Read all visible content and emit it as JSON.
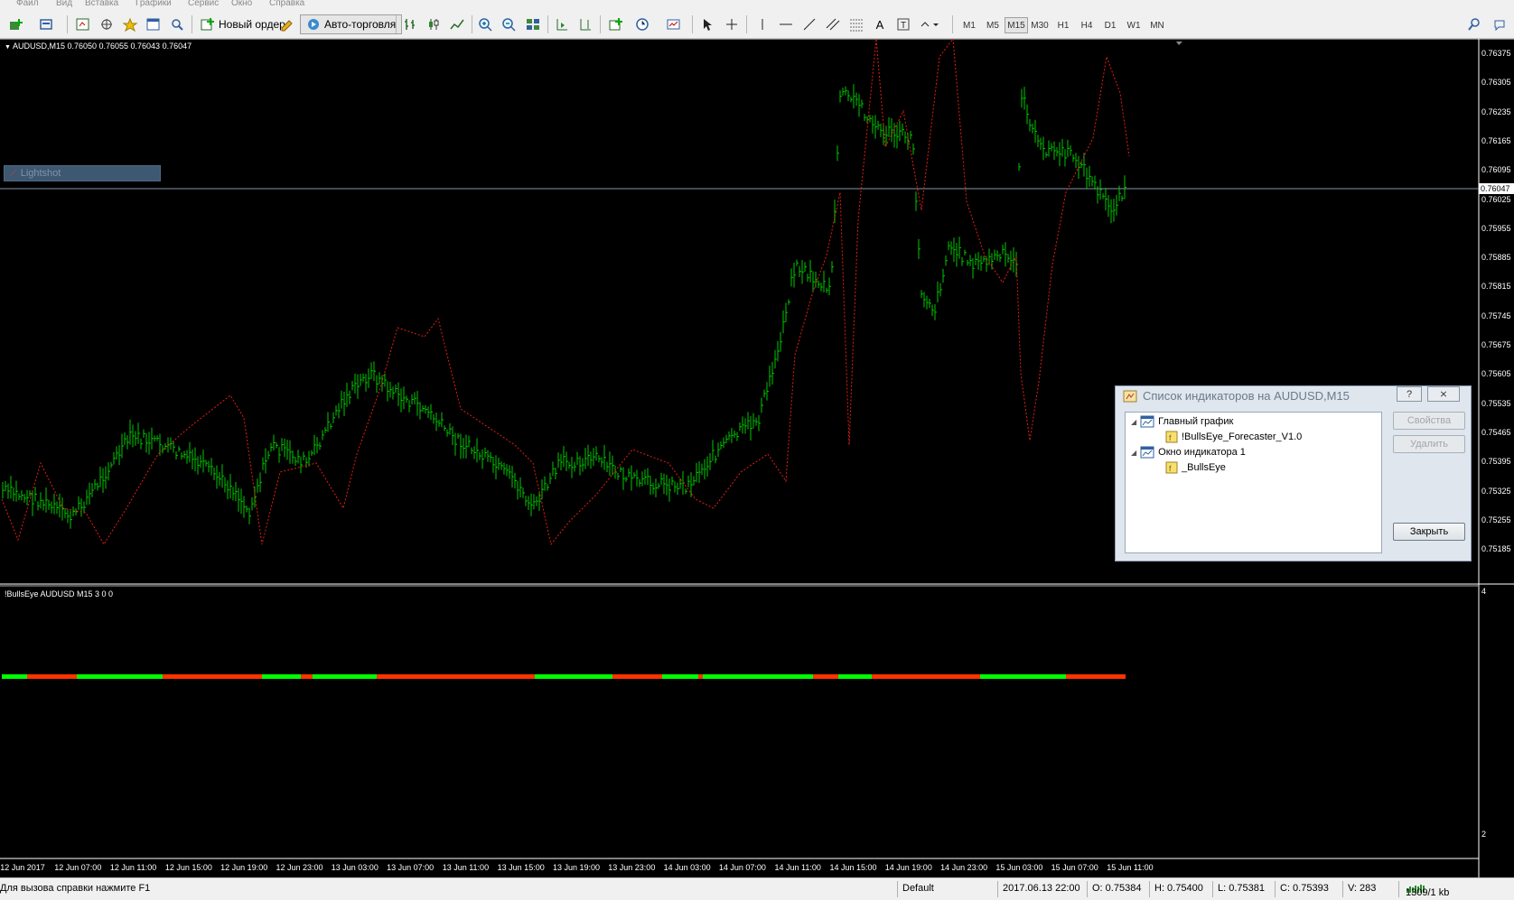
{
  "menu": [
    "Файл",
    "Вид",
    "Вставка",
    "Графики",
    "Сервис",
    "Окно",
    "Справка"
  ],
  "toolbar": {
    "new_order": "Новый ордер",
    "auto_trading": "Авто-торговля",
    "timeframes": [
      "M1",
      "M5",
      "M15",
      "M30",
      "H1",
      "H4",
      "D1",
      "W1",
      "MN"
    ],
    "active_timeframe": "M15"
  },
  "chart": {
    "header": "AUDUSD,M15  0.76050 0.76055 0.76043 0.76047",
    "subwindow_header": "!BullsEye AUDUSD M15 3 0 0",
    "lightshot_label": "Lightshot",
    "current_price": "0.76047",
    "price_labels": [
      "0.76375",
      "0.76305",
      "0.76235",
      "0.76165",
      "0.76095",
      "0.76025",
      "0.75955",
      "0.75885",
      "0.75815",
      "0.75745",
      "0.75675",
      "0.75605",
      "0.75535",
      "0.75465",
      "0.75395",
      "0.75325",
      "0.75255",
      "0.75185"
    ],
    "sub_axis": [
      "4",
      "2"
    ],
    "time_labels": [
      "12 Jun 2017",
      "12 Jun 07:00",
      "12 Jun 11:00",
      "12 Jun 15:00",
      "12 Jun 19:00",
      "12 Jun 23:00",
      "13 Jun 03:00",
      "13 Jun 07:00",
      "13 Jun 11:00",
      "13 Jun 15:00",
      "13 Jun 19:00",
      "13 Jun 23:00",
      "14 Jun 03:00",
      "14 Jun 07:00",
      "14 Jun 11:00",
      "14 Jun 15:00",
      "14 Jun 19:00",
      "14 Jun 23:00",
      "15 Jun 03:00",
      "15 Jun 07:00",
      "15 Jun 11:00"
    ],
    "colors": {
      "bars": "#00c800",
      "forecast": "#e02010",
      "bull": "#00ff00",
      "bear": "#ff3300"
    }
  },
  "dialog": {
    "title": "Список индикаторов на AUDUSD,M15",
    "help": "?",
    "close_x": "⨯",
    "tree": [
      {
        "label": "Главный график"
      },
      {
        "label": "!BullsEye_Forecaster_V1.0"
      },
      {
        "label": "Окно индикатора 1"
      },
      {
        "label": "_BullsEye"
      }
    ],
    "buttons": {
      "properties": "Свойства",
      "delete": "Удалить",
      "close": "Закрыть"
    }
  },
  "status": {
    "help": "Для вызова справки нажмите F1",
    "profile": "Default",
    "datetime": "2017.06.13 22:00",
    "open": "O: 0.75384",
    "high": "H: 0.75400",
    "low": "L: 0.75381",
    "close": "C: 0.75393",
    "volume": "V: 283",
    "traffic": "1309/1 kb"
  }
}
